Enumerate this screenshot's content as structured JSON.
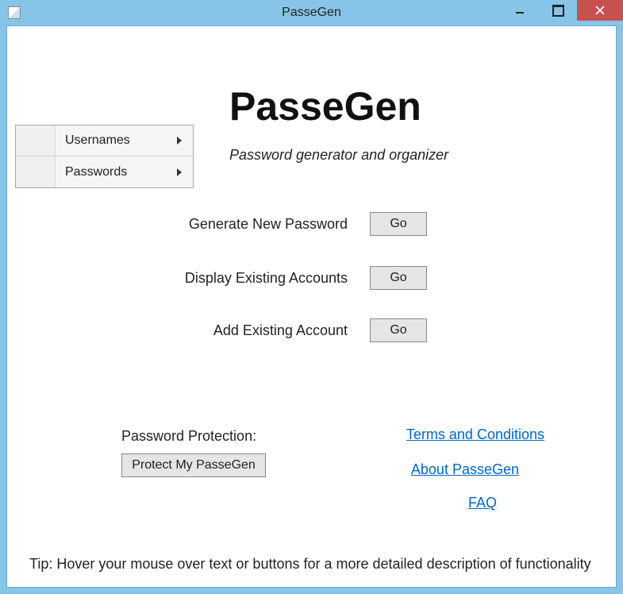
{
  "window": {
    "title": "PasseGen"
  },
  "menu": {
    "items": [
      {
        "label": "Usernames"
      },
      {
        "label": "Passwords"
      }
    ]
  },
  "header": {
    "app_name": "PasseGen",
    "tagline": "Password generator and organizer"
  },
  "actions": {
    "generate": {
      "label": "Generate New Password",
      "button": "Go"
    },
    "display": {
      "label": "Display Existing Accounts",
      "button": "Go"
    },
    "add": {
      "label": "Add Existing Account",
      "button": "Go"
    }
  },
  "protection": {
    "label": "Password Protection:",
    "button": "Protect My PasseGen"
  },
  "links": {
    "terms": "Terms and Conditions",
    "about": "About PasseGen",
    "faq": "FAQ"
  },
  "tip": "Tip: Hover your mouse over text or buttons for a more detailed description of functionality"
}
